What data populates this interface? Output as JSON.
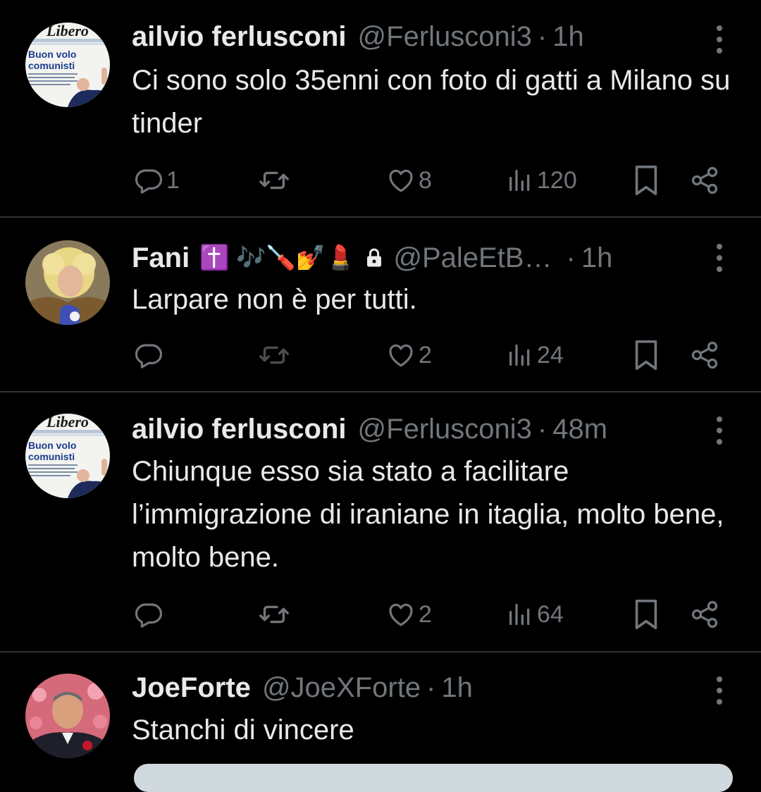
{
  "tweets": [
    {
      "name": "ailvio ferlusconi",
      "emojis": "",
      "locked": false,
      "handle": "@Ferlusconi3",
      "time": "1h",
      "text": "Ci sono solo 35enni con foto di gatti a Milano su tinder",
      "replies": "1",
      "retweets": "",
      "likes": "8",
      "views": "120",
      "avatar": "libero-newspaper-avatar"
    },
    {
      "name": "Fani",
      "emojis": "✝️ 🎶🪛💅💄",
      "locked": true,
      "handle": "@PaleEtB…",
      "time": "1h",
      "text": "Larpare non è per tutti.",
      "replies": "",
      "retweets": "",
      "likes": "2",
      "views": "24",
      "avatar": "blonde-person-avatar"
    },
    {
      "name": "ailvio ferlusconi",
      "emojis": "",
      "locked": false,
      "handle": "@Ferlusconi3",
      "time": "48m",
      "text": "Chiunque esso sia stato a facilitare l’immigrazione di iraniane in itaglia, molto bene, molto bene.",
      "replies": "",
      "retweets": "",
      "likes": "2",
      "views": "64",
      "avatar": "libero-newspaper-avatar"
    },
    {
      "name": "JoeForte",
      "emojis": "",
      "locked": false,
      "handle": "@JoeXForte",
      "time": "1h",
      "text": "Stanchi di vincere",
      "avatar": "man-with-rose-avatar"
    }
  ],
  "libero_avatar": {
    "masthead": "Libero",
    "headline_line1": "Buon volo",
    "headline_line2": "comunisti"
  },
  "colors": {
    "background": "#000000",
    "text": "#e7e9ea",
    "secondary": "#71767b",
    "divider": "#2f3336"
  }
}
